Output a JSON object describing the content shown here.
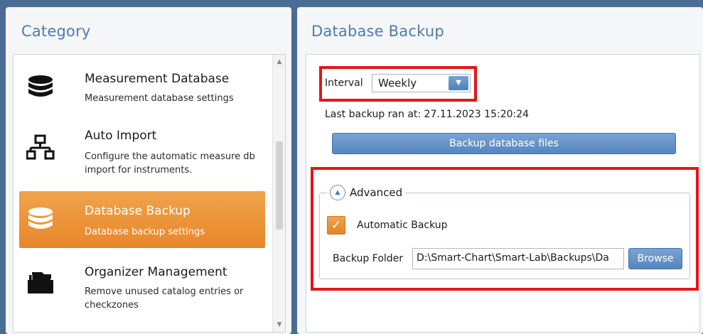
{
  "category_panel": {
    "title": "Category",
    "items": [
      {
        "title": "Measurement Database",
        "subtitle": "Measurement database settings",
        "icon": "database-icon"
      },
      {
        "title": "Auto Import",
        "subtitle": "Configure the automatic measure db import for instruments.",
        "icon": "network-icon"
      },
      {
        "title": "Database Backup",
        "subtitle": "Database backup settings",
        "icon": "database-icon",
        "selected": true
      },
      {
        "title": "Organizer Management",
        "subtitle": "Remove unused catalog entries or checkzones",
        "icon": "folder-icon"
      }
    ]
  },
  "backup_panel": {
    "title": "Database Backup",
    "interval_label": "Interval",
    "interval_value": "Weekly",
    "last_backup": "Last backup ran at: 27.11.2023 15:20:24",
    "backup_button": "Backup database files",
    "advanced_label": "Advanced",
    "automatic_backup_label": "Automatic Backup",
    "automatic_backup_checked": true,
    "folder_label": "Backup Folder",
    "folder_value": "D:\\Smart-Chart\\Smart-Lab\\Backups\\Da",
    "browse_button": "Browse"
  },
  "colors": {
    "accent_blue": "#4f7bab",
    "selected_orange": "#e8862a",
    "highlight_red": "#e4141b"
  }
}
